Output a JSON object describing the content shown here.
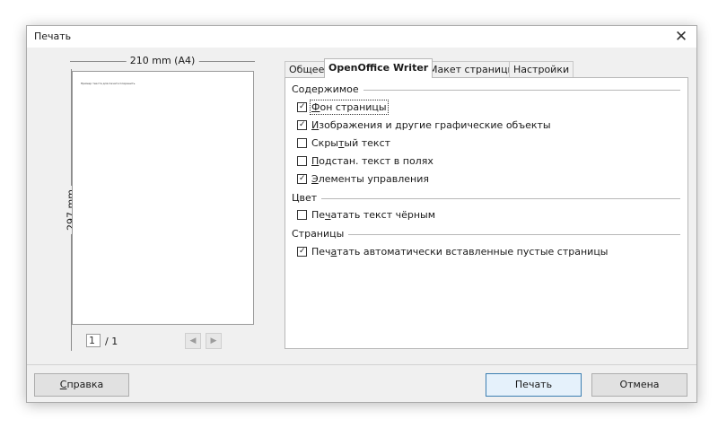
{
  "window": {
    "title": "Печать",
    "close_symbol": "✕"
  },
  "preview": {
    "width_label": "210 mm (A4)",
    "height_label": "297 mm",
    "page_text": "Пример текста для печати Сохранить",
    "page_current": "1",
    "page_total": "/ 1",
    "prev_symbol": "◀",
    "next_symbol": "▶"
  },
  "tabs": [
    {
      "label": "Общее",
      "active": false
    },
    {
      "label": "OpenOffice Writer",
      "active": true
    },
    {
      "label": "Макет страницы",
      "active": false
    },
    {
      "label": "Настройки",
      "active": false
    }
  ],
  "sections": {
    "contents": {
      "title": "Содержимое",
      "items": [
        {
          "label": "Фон страницы",
          "mnemonic": "Ф",
          "checked": true
        },
        {
          "label": "Изображения и другие графические объекты",
          "mnemonic": "И",
          "checked": true
        },
        {
          "label": "Скрытый текст",
          "mnemonic": "т",
          "checked": false
        },
        {
          "label": "Подстан. текст в полях",
          "mnemonic": "П",
          "checked": false
        },
        {
          "label": "Элементы управления",
          "mnemonic": "Э",
          "checked": true
        }
      ]
    },
    "color": {
      "title": "Цвет",
      "items": [
        {
          "label": "Печатать текст чёрным",
          "mnemonic": "ч",
          "checked": false
        }
      ]
    },
    "pages": {
      "title": "Страницы",
      "items": [
        {
          "label": "Печатать автоматически вставленные пустые страницы",
          "mnemonic": "а",
          "checked": true
        }
      ]
    }
  },
  "buttons": {
    "help": "Справка",
    "help_mnemonic": "С",
    "print": "Печать",
    "cancel": "Отмена"
  },
  "checkmark_symbol": "✓"
}
